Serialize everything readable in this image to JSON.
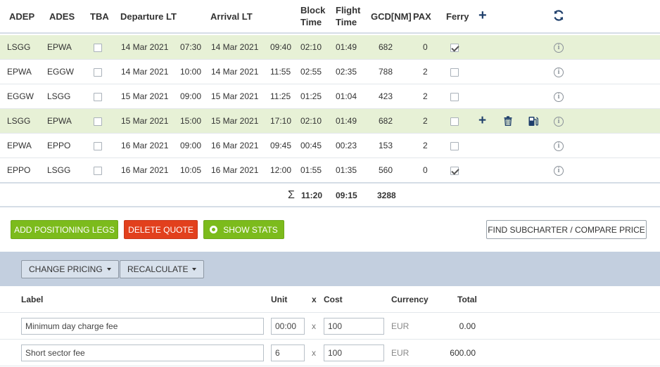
{
  "legs_header": {
    "adep": "ADEP",
    "ades": "ADES",
    "tba": "TBA",
    "departure": "Departure LT",
    "arrival": "Arrival LT",
    "block_l1": "Block",
    "block_l2": "Time",
    "flight_l1": "Flight",
    "flight_l2": "Time",
    "gcd": "GCD[NM]",
    "pax": "PAX",
    "ferry": "Ferry"
  },
  "legs": [
    {
      "adep": "LSGG",
      "ades": "EPWA",
      "tba": false,
      "dep_date": "14 Mar 2021",
      "dep_time": "07:30",
      "arr_date": "14 Mar 2021",
      "arr_time": "09:40",
      "block": "02:10",
      "flight": "01:49",
      "gcd": "682",
      "pax": "0",
      "ferry": true,
      "highlighted": true
    },
    {
      "adep": "EPWA",
      "ades": "EGGW",
      "tba": false,
      "dep_date": "14 Mar 2021",
      "dep_time": "10:00",
      "arr_date": "14 Mar 2021",
      "arr_time": "11:55",
      "block": "02:55",
      "flight": "02:35",
      "gcd": "788",
      "pax": "2",
      "ferry": false,
      "highlighted": false
    },
    {
      "adep": "EGGW",
      "ades": "LSGG",
      "tba": false,
      "dep_date": "15 Mar 2021",
      "dep_time": "09:00",
      "arr_date": "15 Mar 2021",
      "arr_time": "11:25",
      "block": "01:25",
      "flight": "01:04",
      "gcd": "423",
      "pax": "2",
      "ferry": false,
      "highlighted": false
    },
    {
      "adep": "LSGG",
      "ades": "EPWA",
      "tba": false,
      "dep_date": "15 Mar 2021",
      "dep_time": "15:00",
      "arr_date": "15 Mar 2021",
      "arr_time": "17:10",
      "block": "02:10",
      "flight": "01:49",
      "gcd": "682",
      "pax": "2",
      "ferry": false,
      "highlighted": true
    },
    {
      "adep": "EPWA",
      "ades": "EPPO",
      "tba": false,
      "dep_date": "16 Mar 2021",
      "dep_time": "09:00",
      "arr_date": "16 Mar 2021",
      "arr_time": "09:45",
      "block": "00:45",
      "flight": "00:23",
      "gcd": "153",
      "pax": "2",
      "ferry": false,
      "highlighted": false
    },
    {
      "adep": "EPPO",
      "ades": "LSGG",
      "tba": false,
      "dep_date": "16 Mar 2021",
      "dep_time": "10:05",
      "arr_date": "16 Mar 2021",
      "arr_time": "12:00",
      "block": "01:55",
      "flight": "01:35",
      "gcd": "560",
      "pax": "0",
      "ferry": true,
      "highlighted": false
    }
  ],
  "totals": {
    "sigma": "Σ",
    "block": "11:20",
    "flight": "09:15",
    "gcd": "3288"
  },
  "actions": {
    "add_positioning": "ADD POSITIONING LEGS",
    "delete_quote": "DELETE QUOTE",
    "show_stats": "SHOW STATS",
    "find_subcharter": "FIND SUBCHARTER / COMPARE PRICE"
  },
  "pricing_toolbar": {
    "change_pricing": "CHANGE PRICING",
    "recalculate": "RECALCULATE"
  },
  "pricing_header": {
    "label": "Label",
    "unit": "Unit",
    "x": "x",
    "cost": "Cost",
    "currency": "Currency",
    "total": "Total"
  },
  "pricing_rows": [
    {
      "label": "Minimum day charge fee",
      "unit": "00:00",
      "x": "x",
      "cost": "100",
      "currency": "EUR",
      "total": "0.00"
    },
    {
      "label": "Short sector fee",
      "unit": "6",
      "x": "x",
      "cost": "100",
      "currency": "EUR",
      "total": "600.00"
    }
  ],
  "icons": {
    "add": "plus-icon",
    "refresh": "refresh-icon",
    "info": "info-icon",
    "delete": "trash-icon",
    "fuel": "fuel-pump-icon"
  },
  "colors": {
    "highlight_row": "#e7f1d6",
    "green_button": "#7cbb1c",
    "red_button": "#e2401d",
    "pricing_band": "#c3cfdf",
    "icon_blue": "#1f3f6b"
  }
}
